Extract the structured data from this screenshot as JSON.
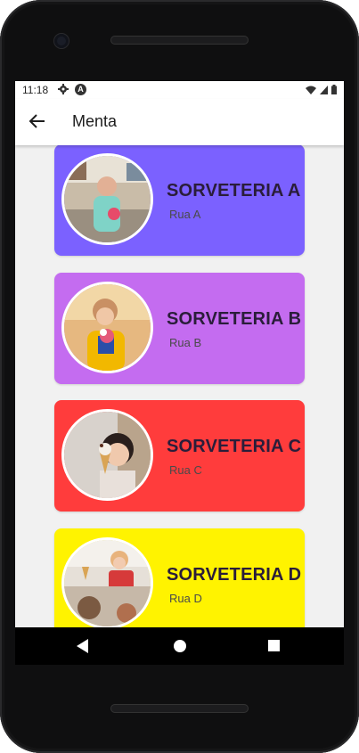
{
  "status": {
    "time": "11:18"
  },
  "appbar": {
    "title": "Menta"
  },
  "cards": [
    {
      "title": "SORVETERIA A",
      "address": "Rua A",
      "color": "#7b61ff"
    },
    {
      "title": "SORVETERIA B",
      "address": "Rua B",
      "color": "#c46cf0"
    },
    {
      "title": "SORVETERIA C",
      "address": "Rua C",
      "color": "#ff3c3c"
    },
    {
      "title": "SORVETERIA D",
      "address": "Rua D",
      "color": "#fff300"
    }
  ]
}
